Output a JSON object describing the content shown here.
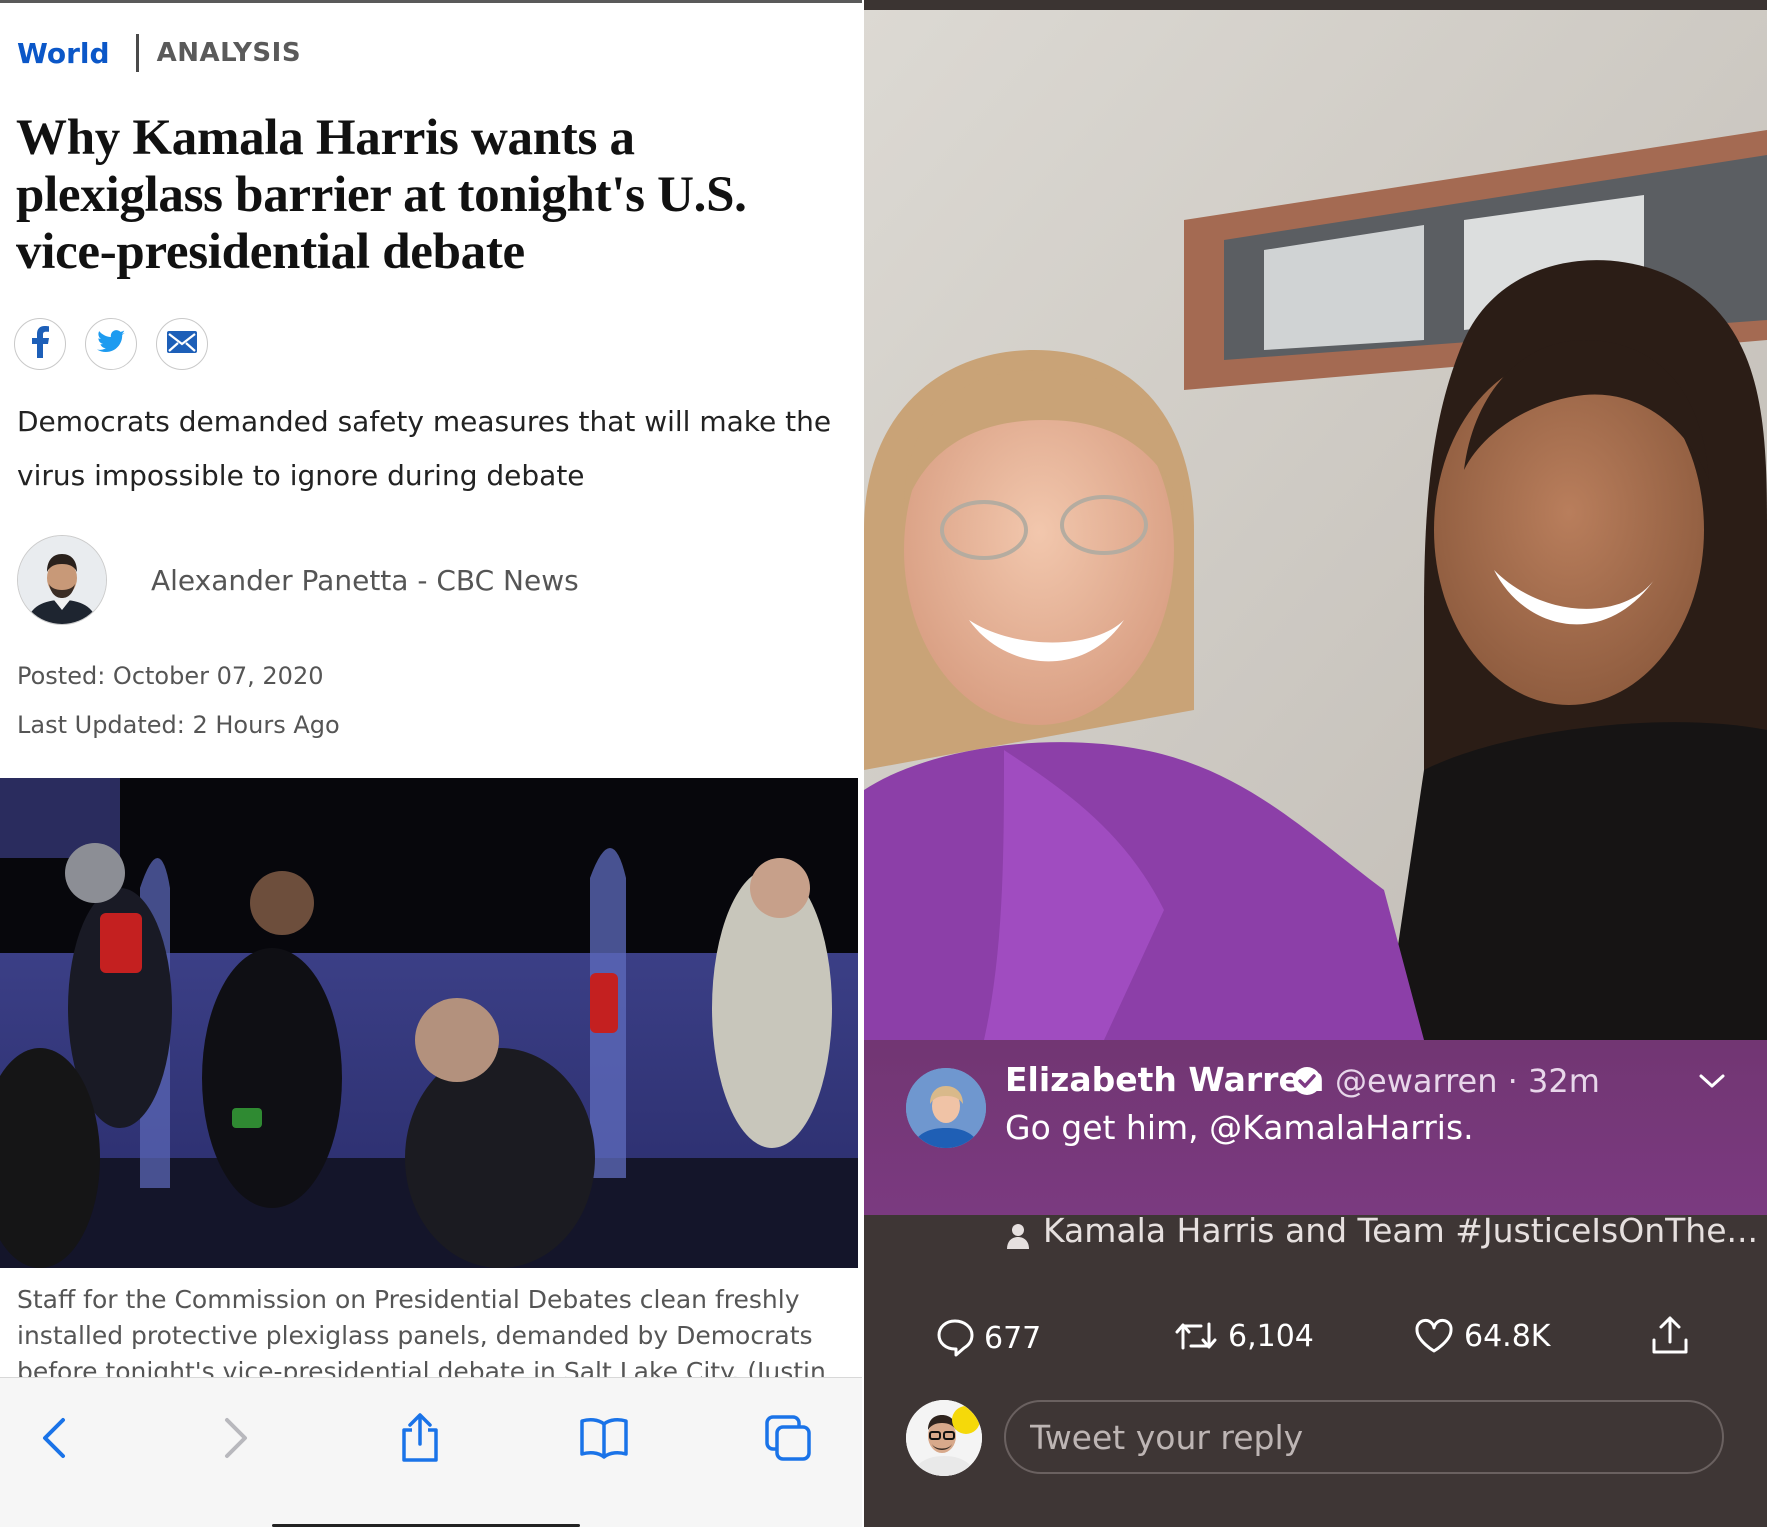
{
  "article": {
    "section": "World",
    "label": "ANALYSIS",
    "headline": "Why Kamala Harris wants a plexiglass barrier at tonight's U.S. vice-presidential debate",
    "dek": "Democrats demanded safety measures that will make the virus impossible to ignore during debate",
    "author": "Alexander Panetta - CBC News",
    "posted": "Posted: October 07, 2020",
    "updated": "Last Updated: 2 Hours Ago",
    "photo_caption": "Staff for the Commission on Presidential Debates clean freshly installed protective plexiglass panels, demanded by Democrats before tonight's vice-presidential debate in Salt Lake City. (Justin",
    "share_icons": [
      "facebook-icon",
      "twitter-icon",
      "email-icon"
    ],
    "colors": {
      "section_blue": "#0b57c8"
    }
  },
  "browser_toolbar": {
    "icons": [
      "back-icon",
      "forward-icon",
      "share-icon",
      "bookmarks-icon",
      "tabs-icon"
    ],
    "accent": "#1a73e8"
  },
  "tweet": {
    "name": "Elizabeth Warren",
    "handle_time": "@ewarren · 32m",
    "text": "Go get him, @KamalaHarris.",
    "credit": "Kamala Harris and Team #JusticeIsOnThe...",
    "replies": "677",
    "retweets": "6,104",
    "likes": "64.8K",
    "reply_placeholder": "Tweet your reply",
    "colors": {
      "overlay_purple": "#7e3a84",
      "panel_bg": "#3e3635"
    }
  }
}
